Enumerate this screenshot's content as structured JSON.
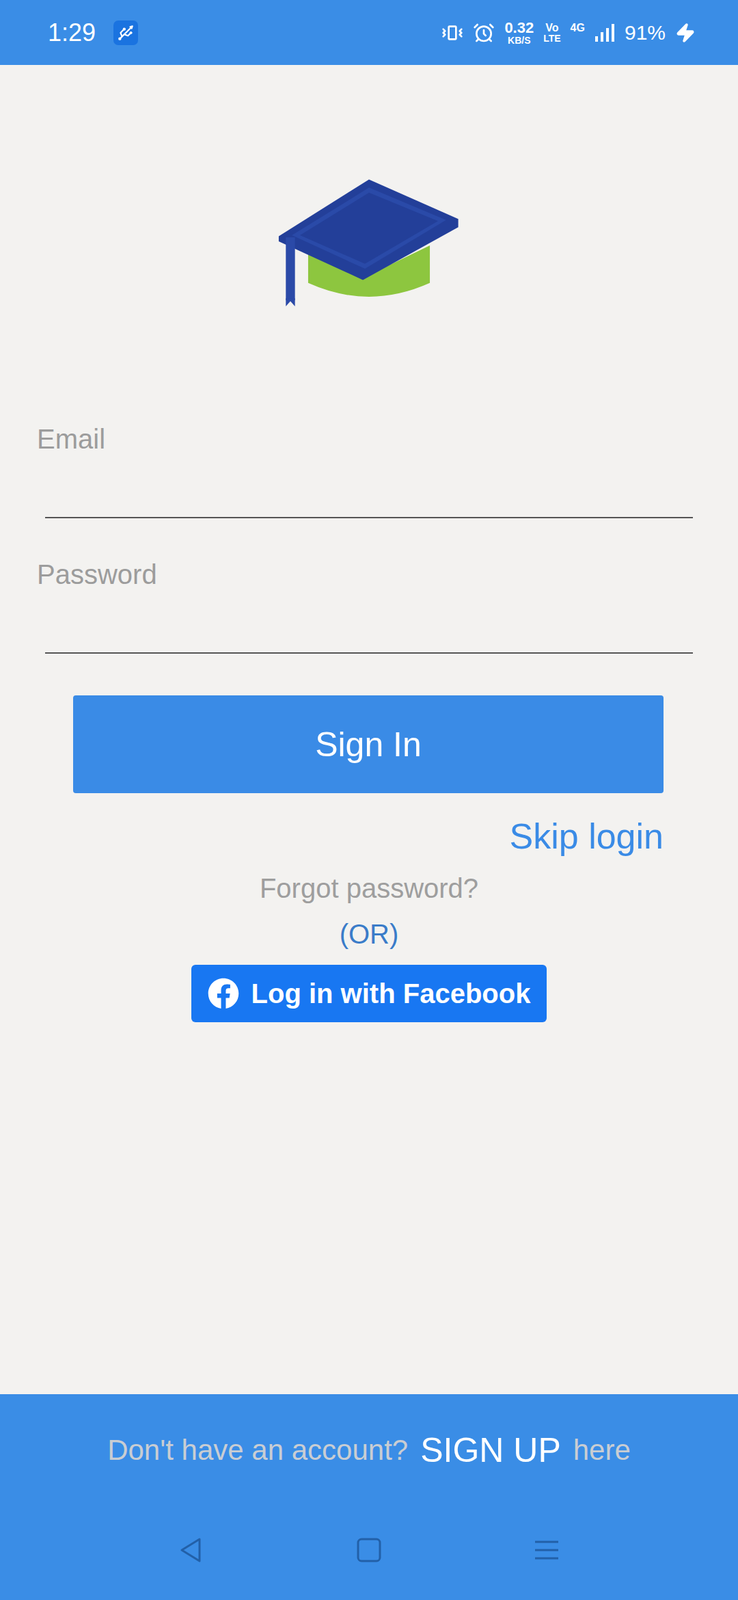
{
  "status_bar": {
    "time": "1:29",
    "network_speed": "0.32",
    "network_unit": "KB/S",
    "volte_top": "Vo",
    "volte_bottom": "LTE",
    "network_type": "4G",
    "battery": "91%",
    "charging": true
  },
  "form": {
    "fields": [
      {
        "label": "Email",
        "kind": "email"
      },
      {
        "label": "Password",
        "kind": "password"
      }
    ]
  },
  "sign_in_button": "Sign In",
  "skip_login": "Skip login",
  "forgot_password": "Forgot password?",
  "separator": "(OR)",
  "facebook_button": "Log in with Facebook",
  "footer": {
    "prompt": "Don't have an account?",
    "action": "SIGN UP",
    "suffix": "here"
  }
}
